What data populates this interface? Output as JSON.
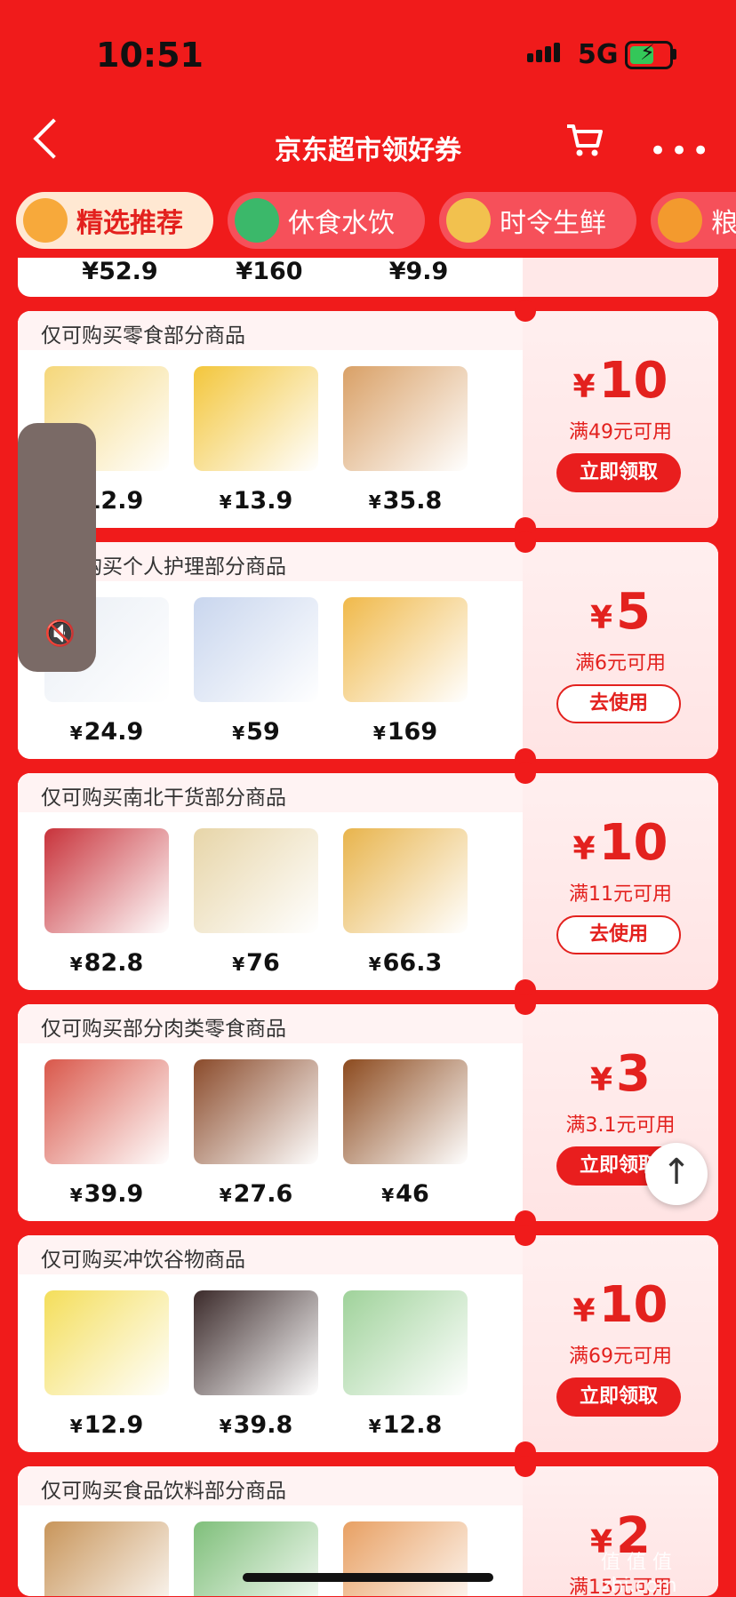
{
  "status_bar": {
    "time": "10:51",
    "network": "5G"
  },
  "nav": {
    "title": "京东超市领好券"
  },
  "tabs": [
    {
      "label": "精选推荐",
      "active": true,
      "color": "#F7A93B"
    },
    {
      "label": "休食水饮",
      "active": false,
      "color": "#3BB86A"
    },
    {
      "label": "时令生鲜",
      "active": false,
      "color": "#F2C14E"
    },
    {
      "label": "粮",
      "active": false,
      "color": "#F39A2E"
    }
  ],
  "top_partial": {
    "prices": [
      "¥52.9",
      "¥160",
      "¥9.9"
    ]
  },
  "coupons": [
    {
      "header": "仅可购买零食部分商品",
      "products": [
        {
          "price": "12.9",
          "color": "#F5D77A"
        },
        {
          "price": "13.9",
          "color": "#F3C63B"
        },
        {
          "price": "35.8",
          "color": "#D9A066"
        }
      ],
      "amount": "10",
      "condition": "满49元可用",
      "button": "立即领取",
      "button_type": "claim"
    },
    {
      "header": "仅可购买个人护理部分商品",
      "products": [
        {
          "price": "24.9",
          "color": "#E9EEF5"
        },
        {
          "price": "59",
          "color": "#C9D6EE"
        },
        {
          "price": "169",
          "color": "#F0B94A"
        }
      ],
      "amount": "5",
      "condition": "满6元可用",
      "button": "去使用",
      "button_type": "use"
    },
    {
      "header": "仅可购买南北干货部分商品",
      "products": [
        {
          "price": "82.8",
          "color": "#C8323A"
        },
        {
          "price": "76",
          "color": "#E7D5A8"
        },
        {
          "price": "66.3",
          "color": "#E8B44C"
        }
      ],
      "amount": "10",
      "condition": "满11元可用",
      "button": "去使用",
      "button_type": "use"
    },
    {
      "header": "仅可购买部分肉类零食商品",
      "products": [
        {
          "price": "39.9",
          "color": "#D9574A"
        },
        {
          "price": "27.6",
          "color": "#8A4A2A"
        },
        {
          "price": "46",
          "color": "#8C4A1E"
        }
      ],
      "amount": "3",
      "condition": "满3.1元可用",
      "button": "立即领取",
      "button_type": "claim"
    },
    {
      "header": "仅可购买冲饮谷物商品",
      "products": [
        {
          "price": "12.9",
          "color": "#F4DE5A"
        },
        {
          "price": "39.8",
          "color": "#3B2A2A"
        },
        {
          "price": "12.8",
          "color": "#9FD29A"
        }
      ],
      "amount": "10",
      "condition": "满69元可用",
      "button": "立即领取",
      "button_type": "claim"
    },
    {
      "header": "仅可购买食品饮料部分商品",
      "products": [
        {
          "price": "",
          "color": "#C8955A"
        },
        {
          "price": "",
          "color": "#7FBF7A"
        },
        {
          "price": "",
          "color": "#E8A063"
        }
      ],
      "amount": "2",
      "condition": "满15元可用",
      "button": "",
      "button_type": "claim"
    }
  ],
  "currency": "¥",
  "watermark": "值 值 值",
  "watermark_url": "zhi.com"
}
